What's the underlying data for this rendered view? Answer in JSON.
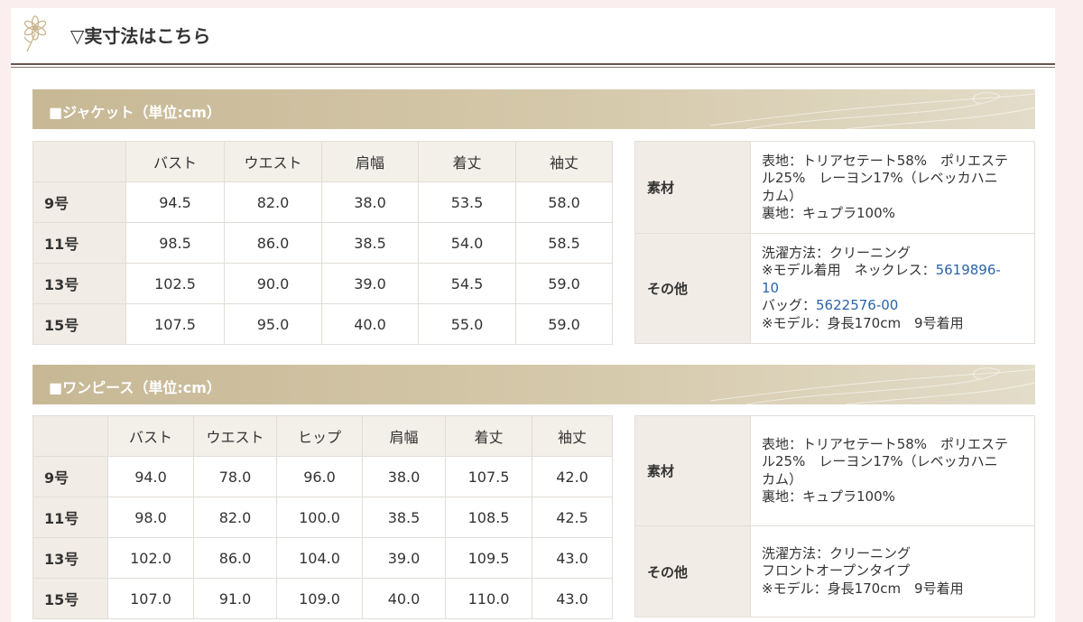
{
  "page": {
    "title": "▽実寸法はこちら"
  },
  "jacket": {
    "section_title": "■ジャケット（単位:cm）",
    "columns": [
      "バスト",
      "ウエスト",
      "肩幅",
      "着丈",
      "袖丈"
    ],
    "rows": [
      {
        "size": "9号",
        "values": [
          "94.5",
          "82.0",
          "38.0",
          "53.5",
          "58.0"
        ]
      },
      {
        "size": "11号",
        "values": [
          "98.5",
          "86.0",
          "38.5",
          "54.0",
          "58.5"
        ]
      },
      {
        "size": "13号",
        "values": [
          "102.5",
          "90.0",
          "39.0",
          "54.5",
          "59.0"
        ]
      },
      {
        "size": "15号",
        "values": [
          "107.5",
          "95.0",
          "40.0",
          "55.0",
          "59.0"
        ]
      }
    ],
    "info": {
      "material_label": "素材",
      "material_lines": [
        "表地：トリアセテート58%　ポリエステ",
        "ル25%　レーヨン17%（レベッカハニ",
        "カム）",
        "裏地：キュプラ100%"
      ],
      "other_label": "その他",
      "wash": "洗濯方法：クリーニング",
      "necklace_prefix": "※モデル着用　ネックレス：",
      "necklace_code_1": "5619896-",
      "necklace_code_2": "10",
      "bag_prefix": "バッグ：",
      "bag_code": "5622576-00",
      "model": "※モデル：身長170cm　9号着用"
    }
  },
  "onepiece": {
    "section_title": "■ワンピース（単位:cm）",
    "columns": [
      "バスト",
      "ウエスト",
      "ヒップ",
      "肩幅",
      "着丈",
      "袖丈"
    ],
    "rows": [
      {
        "size": "9号",
        "values": [
          "94.0",
          "78.0",
          "96.0",
          "38.0",
          "107.5",
          "42.0"
        ]
      },
      {
        "size": "11号",
        "values": [
          "98.0",
          "82.0",
          "100.0",
          "38.5",
          "108.5",
          "42.5"
        ]
      },
      {
        "size": "13号",
        "values": [
          "102.0",
          "86.0",
          "104.0",
          "39.0",
          "109.5",
          "43.0"
        ]
      },
      {
        "size": "15号",
        "values": [
          "107.0",
          "91.0",
          "109.0",
          "40.0",
          "110.0",
          "43.0"
        ]
      }
    ],
    "info": {
      "material_label": "素材",
      "material_lines": [
        "表地：トリアセテート58%　ポリエステ",
        "ル25%　レーヨン17%（レベッカハニ",
        "カム）",
        "裏地：キュプラ100%"
      ],
      "other_label": "その他",
      "other_lines": [
        "洗濯方法：クリーニング",
        "フロントオープンタイプ",
        "※モデル：身長170cm　9号着用"
      ]
    }
  }
}
